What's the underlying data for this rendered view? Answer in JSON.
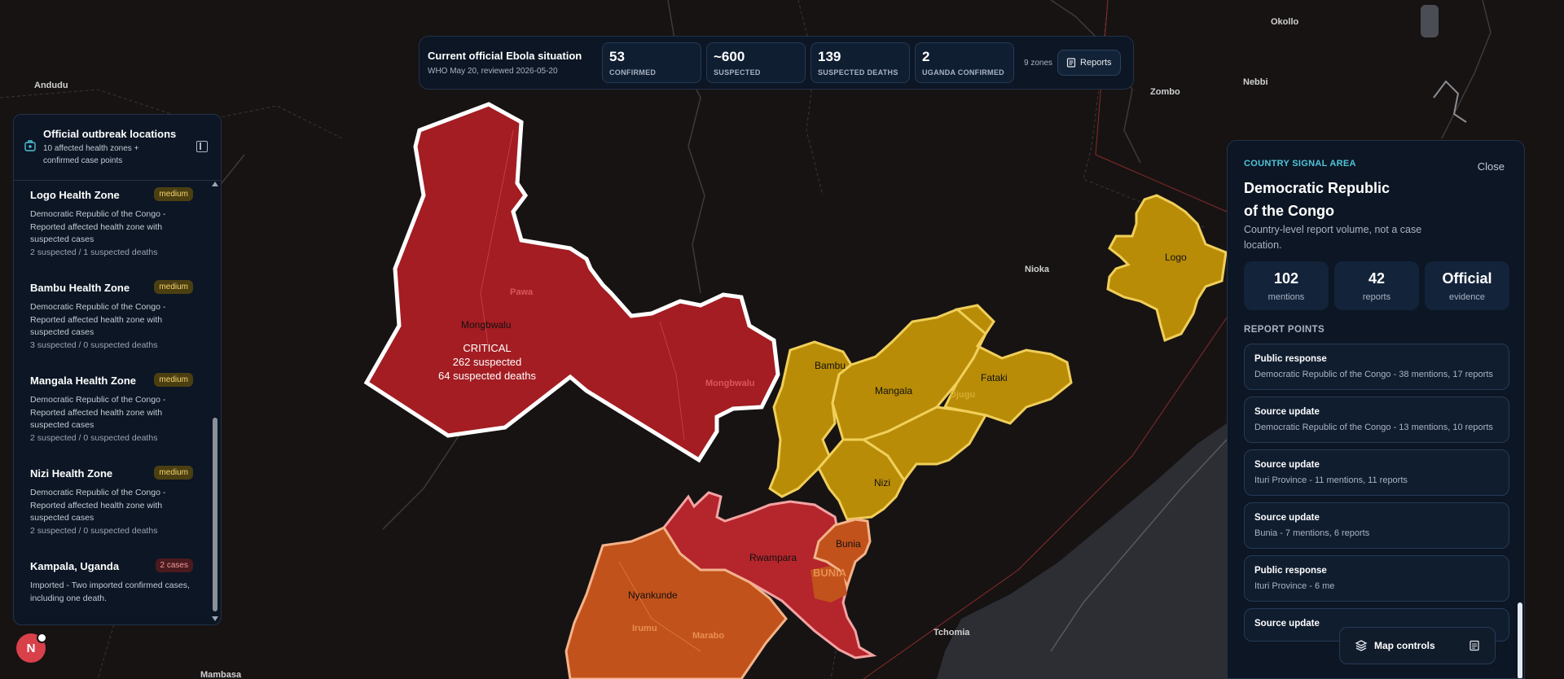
{
  "summary": {
    "title": "Current official Ebola situation",
    "subtitle": "WHO May 20, reviewed 2026-05-20",
    "stats": [
      {
        "value": "53",
        "label": "CONFIRMED"
      },
      {
        "value": "~600",
        "label": "SUSPECTED"
      },
      {
        "value": "139",
        "label": "SUSPECTED DEATHS"
      },
      {
        "value": "2",
        "label": "UGANDA CONFIRMED"
      }
    ],
    "zones_count": "9 zones",
    "reports_label": "Reports"
  },
  "locations_panel": {
    "title": "Official outbreak locations",
    "subtitle": "10 affected health zones + confirmed case points",
    "items": [
      {
        "name": "Logo Health Zone",
        "badge": "medium",
        "desc": "Democratic Republic of the Congo - Reported affected health zone with suspected cases",
        "counts": "2 suspected / 1 suspected deaths"
      },
      {
        "name": "Bambu Health Zone",
        "badge": "medium",
        "desc": "Democratic Republic of the Congo - Reported affected health zone with suspected cases",
        "counts": "3 suspected / 0 suspected deaths"
      },
      {
        "name": "Mangala Health Zone",
        "badge": "medium",
        "desc": "Democratic Republic of the Congo - Reported affected health zone with suspected cases",
        "counts": "2 suspected / 0 suspected deaths"
      },
      {
        "name": "Nizi Health Zone",
        "badge": "medium",
        "desc": "Democratic Republic of the Congo - Reported affected health zone with suspected cases",
        "counts": "2 suspected / 0 suspected deaths"
      },
      {
        "name": "Kampala, Uganda",
        "badge": "2 cases",
        "desc": "Imported - Two imported confirmed cases, including one death.",
        "counts": ""
      }
    ]
  },
  "signal_panel": {
    "tag": "COUNTRY SIGNAL AREA",
    "close_label": "Close",
    "title": "Democratic Republic of the Congo",
    "subtitle": "Country-level report volume, not a case location.",
    "metrics": [
      {
        "value": "102",
        "label": "mentions"
      },
      {
        "value": "42",
        "label": "reports"
      },
      {
        "value": "Official",
        "label": "evidence"
      }
    ],
    "section_label": "REPORT POINTS",
    "report_points": [
      {
        "heading": "Public response",
        "detail": "Democratic Republic of the Congo - 38 mentions, 17 reports"
      },
      {
        "heading": "Source update",
        "detail": "Democratic Republic of the Congo - 13 mentions, 10 reports"
      },
      {
        "heading": "Source update",
        "detail": "Ituri Province - 11 mentions, 11 reports"
      },
      {
        "heading": "Source update",
        "detail": "Bunia - 7 mentions, 6 reports"
      },
      {
        "heading": "Public response",
        "detail": "Ituri Province - 6 me"
      },
      {
        "heading": "Source update",
        "detail": ""
      }
    ]
  },
  "map_controls_label": "Map controls",
  "avatar_letter": "N",
  "map": {
    "place_labels": [
      "Andudu",
      "Okollo",
      "Zombo",
      "Nebbi",
      "Nioka",
      "Tchomia",
      "Mambasa"
    ],
    "zone_labels": [
      "Mongbwalu",
      "Logo",
      "Bambu",
      "Mangala",
      "Fataki",
      "Nizi",
      "Rwampara",
      "Bunia",
      "Nyankunde"
    ],
    "ghost_labels": [
      "Pawa",
      "Mongbwalu",
      "Djugu",
      "BUNIA",
      "Irumu",
      "Marabo"
    ],
    "critical_callout": {
      "status": "CRITICAL",
      "suspected": "262 suspected",
      "deaths": "64 suspected deaths"
    },
    "colors": {
      "critical": "#a31d22",
      "high": "#b5252c",
      "medium": "#b88c07",
      "orange": "#c2521b",
      "border": "#ffffff"
    }
  }
}
